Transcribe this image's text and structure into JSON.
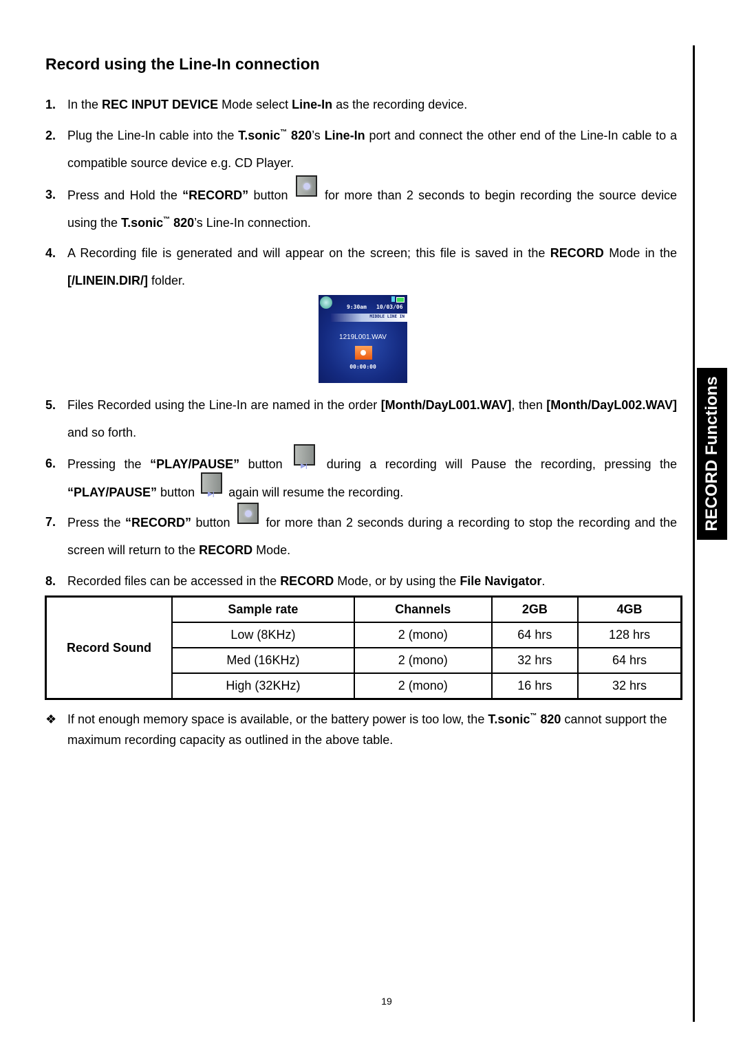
{
  "section_tab": "RECORD Functions",
  "title": "Record using the Line-In connection",
  "steps": [
    {
      "num": "1.",
      "parts": [
        "In the ",
        "REC INPUT DEVICE",
        " Mode select ",
        "Line-In",
        " as the recording device."
      ]
    },
    {
      "num": "2.",
      "parts": [
        "Plug the Line-In cable into the ",
        "T.sonic",
        "™",
        " 820",
        "’s ",
        "Line-In",
        " port and connect the other end of the Line-In cable to a compatible source device e.g. CD Player."
      ]
    },
    {
      "num": "3.",
      "parts": [
        "Press and Hold the ",
        "“RECORD”",
        " button",
        "for more than 2 seconds to begin recording the source device using the ",
        "T.sonic",
        "™",
        " 820",
        "’s Line-In connection."
      ]
    },
    {
      "num": "4.",
      "parts": [
        "A Recording file is generated and will appear on the screen; this file is saved in the ",
        "RECORD",
        " Mode in the ",
        "[/LINEIN.DIR/]",
        " folder."
      ]
    },
    {
      "num": "5.",
      "parts": [
        "Files Recorded using the Line-In are named in the order ",
        "[Month/DayL001.WAV]",
        ", then ",
        "[Month/DayL002.WAV]",
        " and so forth."
      ]
    },
    {
      "num": "6.",
      "parts": [
        "Pressing the ",
        "“PLAY/PAUSE”",
        " button",
        "during a recording will Pause the recording, pressing the ",
        "“PLAY/PAUSE”",
        " button",
        "again will resume the recording."
      ]
    },
    {
      "num": "7.",
      "parts": [
        "Press the ",
        "“RECORD”",
        " button",
        "for more than 2 seconds during a recording to stop the recording and the screen will return to the ",
        "RECORD",
        " Mode."
      ]
    },
    {
      "num": "8.",
      "parts": [
        "Recorded files can be accessed in the ",
        "RECORD",
        " Mode, or by using the ",
        "File Navigator",
        "."
      ]
    }
  ],
  "device_screen": {
    "time": "9:30am",
    "date": "10/03/06",
    "mode": "MIDDLE LINE IN",
    "filename": "1219L001.WAV",
    "counter": "00:00:00"
  },
  "table": {
    "row_header": "Record Sound",
    "columns": [
      "Sample rate",
      "Channels",
      "2GB",
      "4GB"
    ],
    "rows": [
      [
        "Low (8KHz)",
        "2 (mono)",
        "64 hrs",
        "128 hrs"
      ],
      [
        "Med (16KHz)",
        "2 (mono)",
        "32 hrs",
        "64 hrs"
      ],
      [
        "High (32KHz)",
        "2 (mono)",
        "16 hrs",
        "32 hrs"
      ]
    ]
  },
  "note": {
    "bullet": "❖",
    "parts": [
      "If not enough memory space is available, or the battery power is too low, the ",
      "T.sonic",
      "™",
      " 820",
      " cannot support the maximum recording capacity as outlined in the above table."
    ]
  },
  "page_number": "19"
}
